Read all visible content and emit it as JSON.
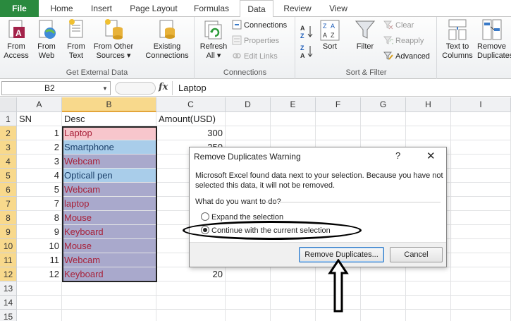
{
  "tabs": [
    {
      "label": "File"
    },
    {
      "label": "Home"
    },
    {
      "label": "Insert"
    },
    {
      "label": "Page Layout"
    },
    {
      "label": "Formulas"
    },
    {
      "label": "Data"
    },
    {
      "label": "Review"
    },
    {
      "label": "View"
    }
  ],
  "ribbon": {
    "get_external": {
      "group_label": "Get External Data",
      "from_access": "From\nAccess",
      "from_web": "From\nWeb",
      "from_text": "From\nText",
      "from_other": "From Other\nSources ▾",
      "existing": "Existing\nConnections"
    },
    "connections": {
      "group_label": "Connections",
      "refresh": "Refresh\nAll ▾",
      "connections": "Connections",
      "properties": "Properties",
      "edit_links": "Edit Links"
    },
    "sort_filter": {
      "group_label": "Sort & Filter",
      "sort": "Sort",
      "filter": "Filter",
      "clear": "Clear",
      "reapply": "Reapply",
      "advanced": "Advanced"
    },
    "data_tools": {
      "text_to_columns": "Text to\nColumns",
      "remove_duplicates": "Remove\nDuplicates"
    }
  },
  "formula_bar": {
    "name_box": "B2",
    "fx": "fx",
    "formula": "Laptop"
  },
  "grid": {
    "columns": [
      "A",
      "B",
      "C",
      "D",
      "E",
      "F",
      "G",
      "H",
      "I"
    ],
    "rows": [
      "1",
      "2",
      "3",
      "4",
      "5",
      "6",
      "7",
      "8",
      "9",
      "10",
      "11",
      "12",
      "13",
      "14",
      "15"
    ],
    "header_row": {
      "a": "SN",
      "b": "Desc",
      "c": "Amount(USD)"
    },
    "data": [
      {
        "sn": "1",
        "desc": "Laptop",
        "amount": "300",
        "fill": "#f7c6cc",
        "color": "red"
      },
      {
        "sn": "2",
        "desc": "Smartphone",
        "amount": "250",
        "fill": "#a9cdea",
        "color": "blue"
      },
      {
        "sn": "3",
        "desc": "Webcam",
        "amount": "",
        "fill": "#a9a9cc",
        "color": "red"
      },
      {
        "sn": "4",
        "desc": "Opticall pen",
        "amount": "",
        "fill": "#a9cdea",
        "color": "blue"
      },
      {
        "sn": "5",
        "desc": "Webcam",
        "amount": "",
        "fill": "#a9a9cc",
        "color": "red"
      },
      {
        "sn": "7",
        "desc": "laptop",
        "amount": "",
        "fill": "#a9a9cc",
        "color": "red"
      },
      {
        "sn": "8",
        "desc": "Mouse",
        "amount": "",
        "fill": "#a9a9cc",
        "color": "red"
      },
      {
        "sn": "9",
        "desc": "Keyboard",
        "amount": "",
        "fill": "#a9a9cc",
        "color": "red"
      },
      {
        "sn": "10",
        "desc": "Mouse",
        "amount": "",
        "fill": "#a9a9cc",
        "color": "red"
      },
      {
        "sn": "11",
        "desc": "Webcam",
        "amount": "",
        "fill": "#a9a9cc",
        "color": "red"
      },
      {
        "sn": "12",
        "desc": "Keyboard",
        "amount": "20",
        "fill": "#a9a9cc",
        "color": "red"
      }
    ]
  },
  "dialog": {
    "title": "Remove Duplicates Warning",
    "help": "?",
    "close": "✕",
    "message": "Microsoft Excel found data next to your selection. Because you have not selected this data, it will not be removed.",
    "question": "What do you want to do?",
    "option_expand": "Expand the selection",
    "option_continue": "Continue with the current selection",
    "remove_button": "Remove Duplicates...",
    "cancel_button": "Cancel"
  },
  "colors": {
    "file_tab": "#2a8a3e",
    "selected_header": "#f8d98c",
    "red_text": "#a8223a",
    "blue_text": "#1a3f6a"
  }
}
